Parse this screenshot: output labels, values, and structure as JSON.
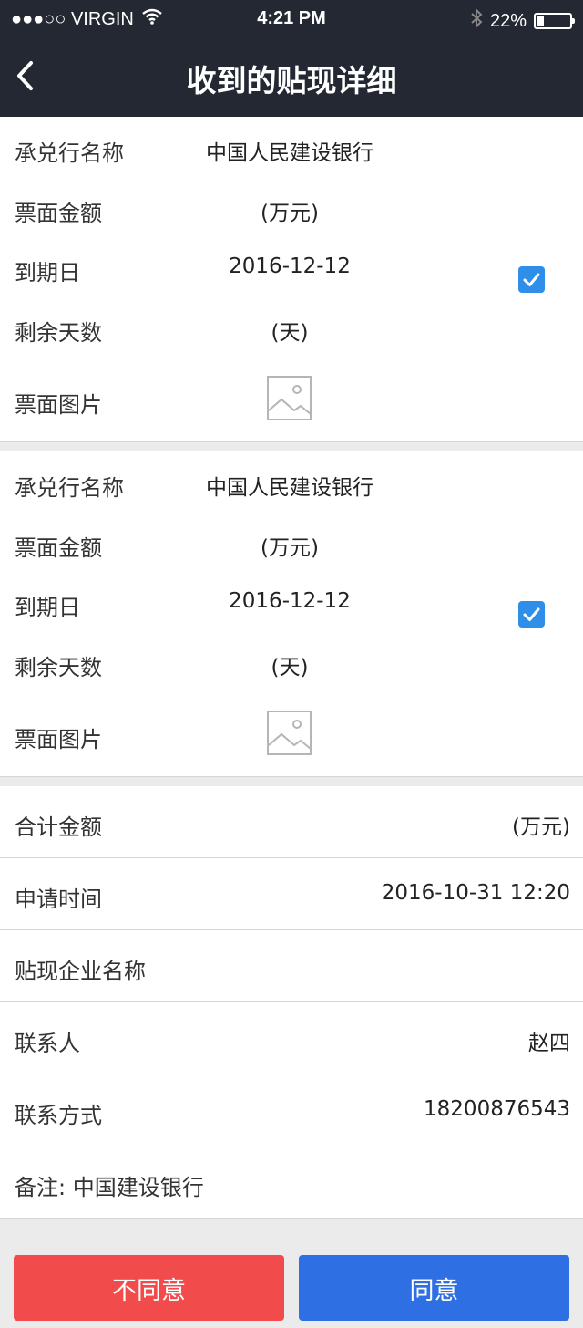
{
  "status_bar": {
    "carrier": "●●●○○ VIRGIN",
    "time": "4:21 PM",
    "battery": "22%",
    "battery_level": 0.22
  },
  "nav": {
    "title": "收到的贴现详细"
  },
  "cards": [
    {
      "bank_label": "承兑行名称",
      "bank_value": "中国人民建设银行",
      "amount_label": "票面金额",
      "amount_value": "(万元)",
      "due_label": "到期日",
      "due_value": "2016-12-12",
      "days_label": "剩余天数",
      "days_value": "(天)",
      "image_label": "票面图片",
      "checked": true
    },
    {
      "bank_label": "承兑行名称",
      "bank_value": "中国人民建设银行",
      "amount_label": "票面金额",
      "amount_value": "(万元)",
      "due_label": "到期日",
      "due_value": "2016-12-12",
      "days_label": "剩余天数",
      "days_value": "(天)",
      "image_label": "票面图片",
      "checked": true
    }
  ],
  "summary": {
    "total_label": "合计金额",
    "total_value": "(万元)",
    "apply_time_label": "申请时间",
    "apply_time_value": "2016-10-31 12:20",
    "company_label": "贴现企业名称",
    "company_value": "",
    "contact_label": "联系人",
    "contact_value": "赵四",
    "phone_label": "联系方式",
    "phone_value": "18200876543",
    "note_label": "备注: 中国建设银行"
  },
  "buttons": {
    "disagree": "不同意",
    "agree": "同意"
  },
  "colors": {
    "header_bg": "#232833",
    "check_blue": "#2e8ee8",
    "disagree_red": "#f24b4b",
    "agree_blue": "#2e6fe3"
  }
}
